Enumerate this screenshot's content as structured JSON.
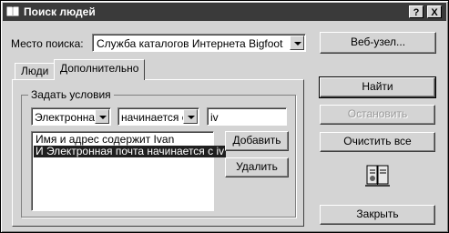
{
  "window": {
    "title": "Поиск людей",
    "help_label": "?",
    "close_label": "X"
  },
  "search_location": {
    "label": "Место поиска:",
    "value": "Служба каталогов Интернета Bigfoot"
  },
  "website_button": "Веб-узел...",
  "tabs": [
    {
      "label": "Люди",
      "active": false
    },
    {
      "label": "Дополнительно",
      "active": true
    }
  ],
  "conditions": {
    "group_label": "Задать условия",
    "field_select": "Электронная",
    "operator_select": "начинается с",
    "value_input": "iv",
    "list": [
      {
        "text": "Имя и адрес содержит Ivan",
        "selected": false
      },
      {
        "text": "И Электронная почта начинается с iv",
        "selected": true
      }
    ],
    "add_button": "Добавить",
    "remove_button": "Удалить"
  },
  "actions": {
    "find": "Найти",
    "stop": "Остановить",
    "clear_all": "Очистить все",
    "close": "Закрыть"
  },
  "icons": [
    "book-icon",
    "address-book-icon"
  ]
}
